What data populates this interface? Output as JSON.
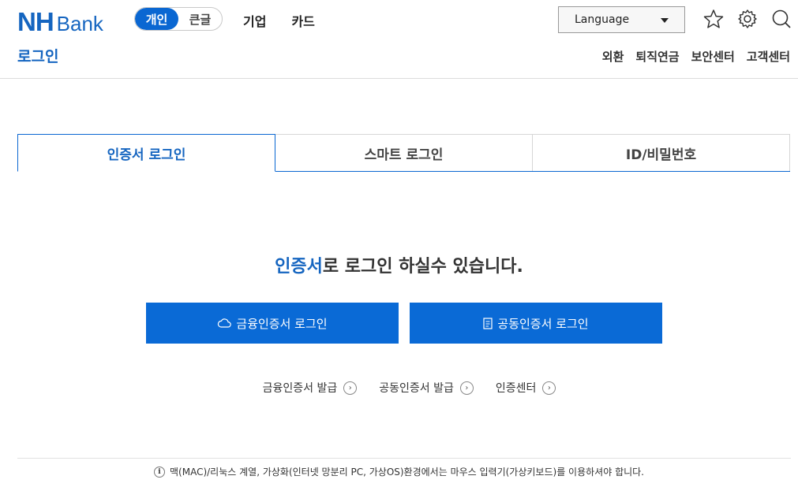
{
  "header": {
    "logo_nh": "NH",
    "logo_bank": "Bank",
    "mode_options": [
      "개인",
      "큰글"
    ],
    "top_nav": [
      "기업",
      "카드"
    ],
    "language_select": "Language",
    "page_title": "로그인",
    "sub_nav": [
      "외환",
      "퇴직연금",
      "보안센터",
      "고객센터"
    ]
  },
  "tabs": [
    {
      "label": "인증서 로그인",
      "active": true
    },
    {
      "label": "스마트 로그인",
      "active": false
    },
    {
      "label": "ID/비밀번호",
      "active": false
    }
  ],
  "main": {
    "headline_highlight": "인증서",
    "headline_rest": "로 로그인 하실수 있습니다.",
    "buttons": [
      {
        "label": "금융인증서 로그인",
        "icon": "cloud-icon"
      },
      {
        "label": "공동인증서 로그인",
        "icon": "document-icon"
      }
    ],
    "links": [
      "금융인증서 발급",
      "공동인증서 발급",
      "인증센터"
    ]
  },
  "footer": {
    "notice": "맥(MAC)/리눅스 계열, 가상화(인터넷 망분리 PC, 가상OS)환경에서는 마우스 입력기(가상키보드)를 이용하셔야 합니다."
  },
  "colors": {
    "brand": "#1565c0",
    "button": "#0a6ad6"
  }
}
